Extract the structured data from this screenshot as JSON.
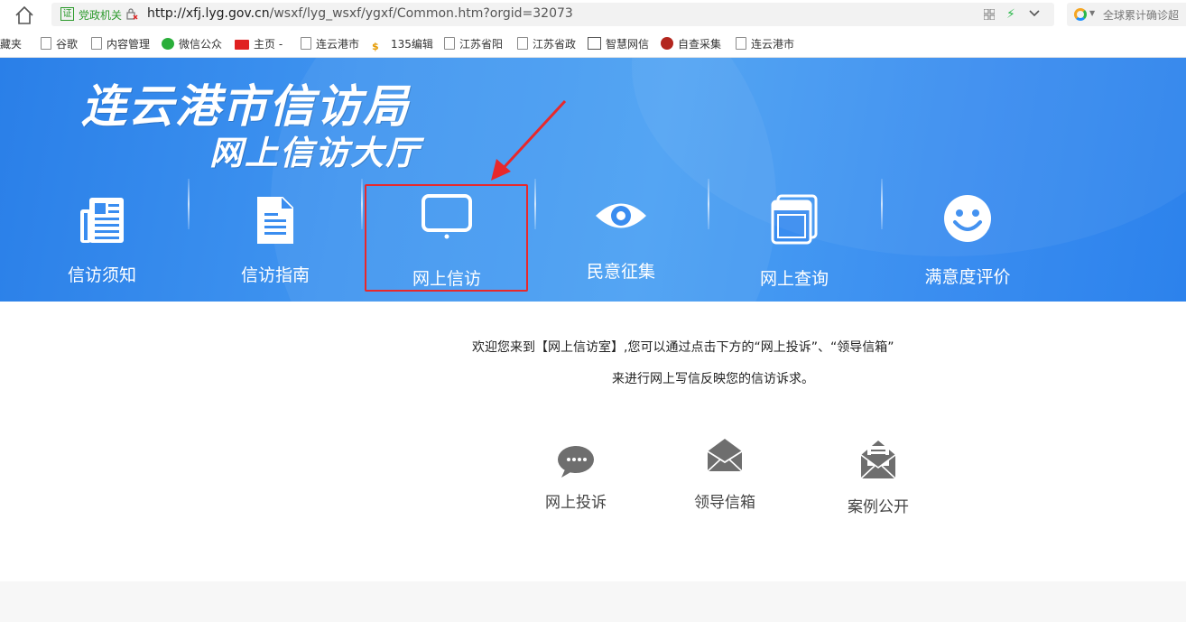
{
  "browser": {
    "cert_icon_text": "证",
    "cert_label": "党政机关",
    "url_host": "http://xfj.lyg.gov.cn",
    "url_path": "/wsxf/lyg_wsxf/ygxf/Common.htm?orgid=32073",
    "search_text": "全球累计确诊超",
    "bookmarks": [
      {
        "label": "收藏夹",
        "icon": "none"
      },
      {
        "label": "谷歌",
        "icon": "page-icon"
      },
      {
        "label": "内容管理",
        "icon": "page-icon"
      },
      {
        "label": "微信公众",
        "icon": "wechat-icon"
      },
      {
        "label": "主页 -",
        "icon": "toutiao-icon"
      },
      {
        "label": "连云港市",
        "icon": "page-icon"
      },
      {
        "label": "135编辑",
        "icon": "135-icon"
      },
      {
        "label": "江苏省阳",
        "icon": "page-icon"
      },
      {
        "label": "江苏省政",
        "icon": "page-icon"
      },
      {
        "label": "智慧网信",
        "icon": "zhihui-icon"
      },
      {
        "label": "自查采集",
        "icon": "police-badge-icon"
      },
      {
        "label": "连云港市",
        "icon": "page-icon"
      }
    ]
  },
  "banner": {
    "title": "连云港市信访局",
    "subtitle": "网上信访大厅",
    "nav": [
      {
        "label": "信访须知",
        "icon": "newspaper-icon"
      },
      {
        "label": "信访指南",
        "icon": "document-icon"
      },
      {
        "label": "网上信访",
        "icon": "monitor-icon",
        "selected": true
      },
      {
        "label": "民意征集",
        "icon": "eye-icon"
      },
      {
        "label": "网上查询",
        "icon": "window-stack-icon"
      },
      {
        "label": "满意度评价",
        "icon": "smiley-icon"
      }
    ]
  },
  "content": {
    "welcome_line1": "欢迎您来到【网上信访室】,您可以通过点击下方的“网上投诉”、“领导信箱”",
    "welcome_line2": "来进行网上写信反映您的信访诉求。",
    "actions": [
      {
        "label": "网上投诉",
        "icon": "chat-bubble-icon"
      },
      {
        "label": "领导信箱",
        "icon": "envelope-icon"
      },
      {
        "label": "案例公开",
        "icon": "open-mail-icon"
      }
    ]
  },
  "colors": {
    "banner_blue": "#3a8df0",
    "highlight_red": "#e8282b",
    "icon_gray": "#6e6e6e",
    "cert_green": "#2b9a2b"
  }
}
